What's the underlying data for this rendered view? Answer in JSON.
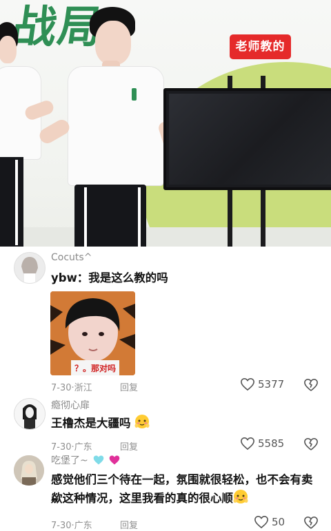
{
  "video": {
    "brand_text": "战局",
    "caption_tag": "老师教的"
  },
  "comments": [
    {
      "username": "Cocuts^",
      "text": "ybw：我是这么教的吗",
      "sticker_caption": "？。那对吗",
      "date": "7-30",
      "location": "浙江",
      "reply_label": "回复",
      "likes": "5377"
    },
    {
      "username": "瘾彻心扉",
      "text": "王橹杰是大疆吗",
      "date": "7-30",
      "location": "广东",
      "reply_label": "回复",
      "likes": "5585"
    },
    {
      "username": "吃堡了~",
      "text": "感觉他们三个待在一起，氛围就很轻松，也不会有卖歘这种情况，这里我看的真的很心顺",
      "date": "7-30",
      "location": "广东",
      "reply_label": "回复",
      "likes": "50"
    }
  ],
  "icons": {
    "like": "heart-outline-icon",
    "dislike": "broken-heart-icon",
    "blush": "blushing-face-emoji"
  },
  "colors": {
    "tag_bg": "#e52a2a",
    "brand_green": "#2f8f55",
    "muted_text": "#8f8f8f"
  }
}
